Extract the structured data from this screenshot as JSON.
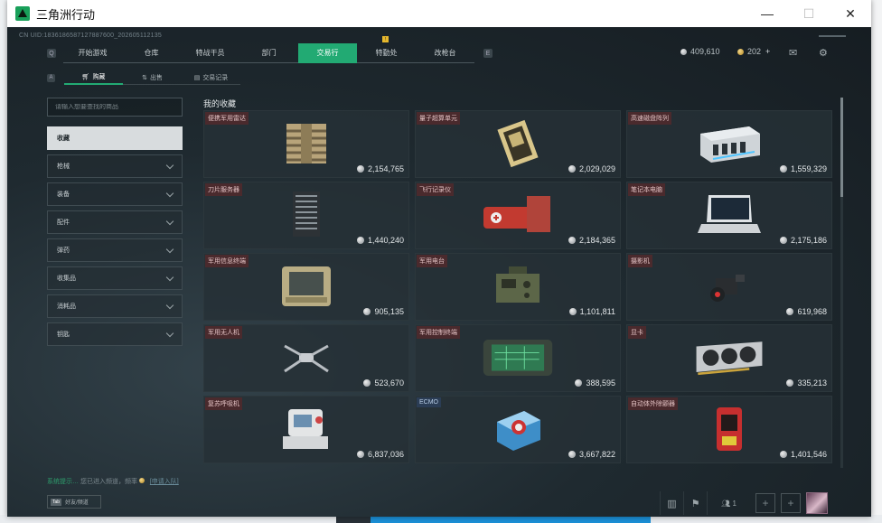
{
  "window": {
    "title": "三角洲行动",
    "min_glyph": "—",
    "max_glyph": "☐",
    "close_glyph": "✕"
  },
  "uid_text": "CN UID:1836186587127887600_202605112135",
  "nav": {
    "left_key": "Q",
    "right_key": "E",
    "tabs": [
      "开始游戏",
      "仓库",
      "特战干员",
      "部门",
      "交易行",
      "特勤处",
      "改枪台"
    ],
    "active_index": 4,
    "notif_badge": "!"
  },
  "currency": {
    "silver": "409,610",
    "gold": "202",
    "plus": "+"
  },
  "icons": {
    "mail": "mail-icon",
    "settings": "gear-icon"
  },
  "subnav": {
    "left_key": "A",
    "tabs": [
      {
        "label": "购藏",
        "icon": "cart-icon"
      },
      {
        "label": "出售",
        "icon": "sell-icon"
      },
      {
        "label": "交易记录",
        "icon": "record-icon"
      }
    ],
    "active_index": 0
  },
  "search": {
    "placeholder": "请输入想要查找的商品"
  },
  "categories": [
    "收藏",
    "枪械",
    "装备",
    "配件",
    "弹药",
    "收集品",
    "消耗品",
    "钥匙"
  ],
  "section_title": "我的收藏",
  "items": [
    {
      "name": "便携军用雷达",
      "price": "2,154,765",
      "icon": "radar-icon"
    },
    {
      "name": "量子超算单元",
      "price": "2,029,029",
      "icon": "processor-icon"
    },
    {
      "name": "高速磁盘阵列",
      "price": "1,559,329",
      "icon": "disk-array-icon"
    },
    {
      "name": "刀片服务器",
      "price": "1,440,240",
      "icon": "server-icon"
    },
    {
      "name": "飞行记录仪",
      "price": "2,184,365",
      "icon": "flight-recorder-icon"
    },
    {
      "name": "笔记本电脑",
      "price": "2,175,186",
      "icon": "laptop-icon"
    },
    {
      "name": "军用信息终端",
      "price": "905,135",
      "icon": "terminal-icon"
    },
    {
      "name": "军用电台",
      "price": "1,101,811",
      "icon": "radio-icon"
    },
    {
      "name": "摄影机",
      "price": "619,968",
      "icon": "camera-icon"
    },
    {
      "name": "军用无人机",
      "price": "523,670",
      "icon": "drone-icon"
    },
    {
      "name": "军用控制终端",
      "price": "388,595",
      "icon": "control-terminal-icon"
    },
    {
      "name": "显卡",
      "price": "335,213",
      "icon": "gpu-icon"
    },
    {
      "name": "复苏呼吸机",
      "price": "6,837,036",
      "icon": "ventilator-icon"
    },
    {
      "name": "ECMO",
      "price": "3,667,822",
      "icon": "ecmo-icon"
    },
    {
      "name": "自动体外除颤器",
      "price": "1,401,546",
      "icon": "defibrillator-icon"
    }
  ],
  "footer": {
    "text_highlight": "系统提示…",
    "text_main": "您已进入频道，频率",
    "link": "[申请入队]",
    "button_key": "Tab",
    "button_label": "好友/频道"
  },
  "bottombar": {
    "friends_count": "1",
    "slot_plus": "+"
  }
}
